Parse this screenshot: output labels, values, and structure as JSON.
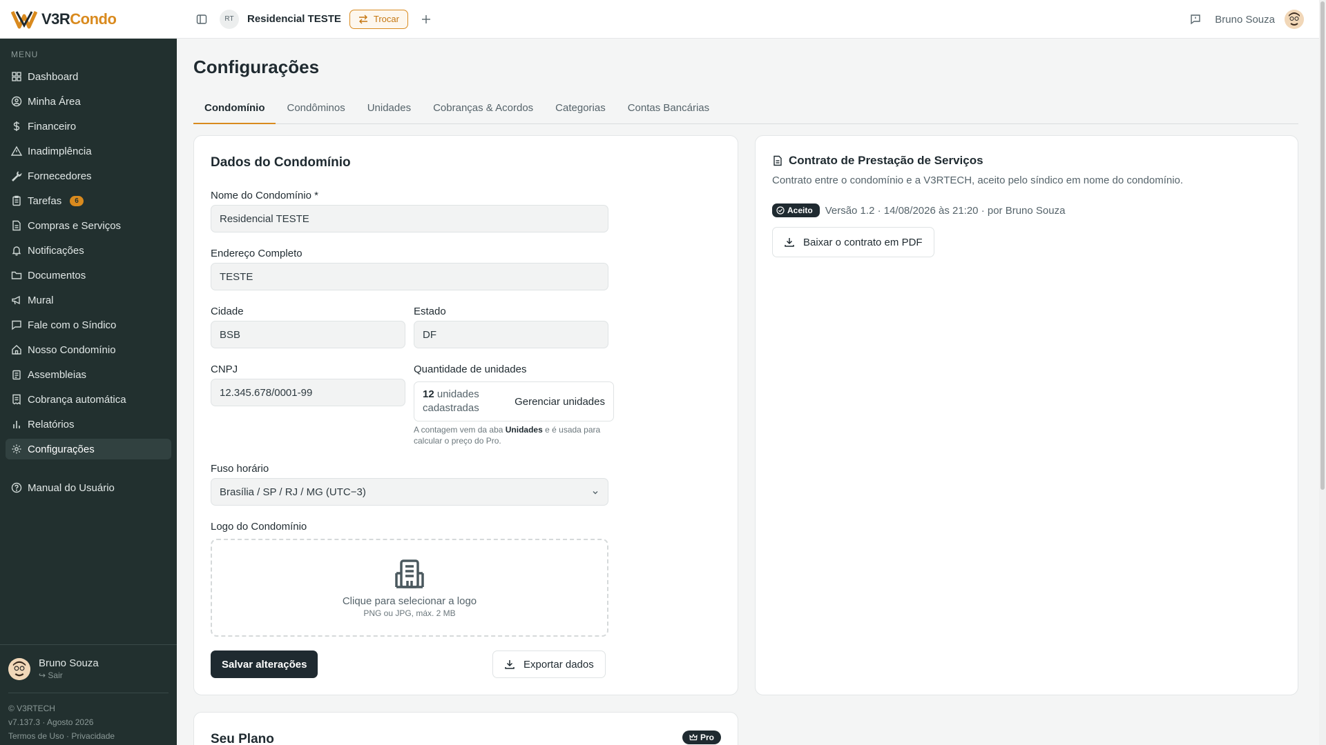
{
  "brand": {
    "logo_prefix": "V3R",
    "logo_suffix": "Condo"
  },
  "header": {
    "condo_initials": "RT",
    "condo_name": "Residencial TESTE",
    "switch_label": "Trocar",
    "user_name": "Bruno Souza"
  },
  "sidebar": {
    "menu_label": "MENU",
    "items": [
      {
        "label": "Dashboard",
        "icon": "grid-icon"
      },
      {
        "label": "Minha Área",
        "icon": "user-circle-icon"
      },
      {
        "label": "Financeiro",
        "icon": "dollar-icon"
      },
      {
        "label": "Inadimplência",
        "icon": "warning-icon"
      },
      {
        "label": "Fornecedores",
        "icon": "wrench-icon"
      },
      {
        "label": "Tarefas",
        "icon": "clipboard-icon",
        "badge": "6"
      },
      {
        "label": "Compras e Serviços",
        "icon": "document-icon"
      },
      {
        "label": "Notificações",
        "icon": "bell-icon"
      },
      {
        "label": "Documentos",
        "icon": "folder-icon"
      },
      {
        "label": "Mural",
        "icon": "megaphone-icon"
      },
      {
        "label": "Fale com o Síndico",
        "icon": "message-icon"
      },
      {
        "label": "Nosso Condomínio",
        "icon": "home-icon"
      },
      {
        "label": "Assembleias",
        "icon": "clipboard-list-icon"
      },
      {
        "label": "Cobrança automática",
        "icon": "receipt-icon"
      },
      {
        "label": "Relatórios",
        "icon": "bar-chart-icon"
      },
      {
        "label": "Configurações",
        "icon": "gear-icon"
      }
    ],
    "manual_label": "Manual do Usuário",
    "user_name": "Bruno Souza",
    "logout_label": "Sair",
    "copyright": "© V3RTECH",
    "version": "v7.137.3 · Agosto 2026",
    "terms_label": "Termos de Uso",
    "privacy_label": "Privacidade"
  },
  "page": {
    "title": "Configurações",
    "tabs": [
      "Condomínio",
      "Condôminos",
      "Unidades",
      "Cobranças & Acordos",
      "Categorias",
      "Contas Bancárias"
    ]
  },
  "form": {
    "title": "Dados do Condomínio",
    "name_label": "Nome do Condomínio *",
    "name_value": "Residencial TESTE",
    "address_label": "Endereço Completo",
    "address_value": "TESTE",
    "city_label": "Cidade",
    "city_value": "BSB",
    "state_label": "Estado",
    "state_value": "DF",
    "cnpj_label": "CNPJ",
    "cnpj_value": "12.345.678/0001-99",
    "units_label": "Quantidade de unidades",
    "units_count": "12",
    "units_suffix": "unidades cadastradas",
    "units_manage": "Gerenciar unidades",
    "units_hint_pre": "A contagem vem da aba",
    "units_hint_tab": "Unidades",
    "units_hint_post": "e é usada para calcular o preço do Pro.",
    "timezone_label": "Fuso horário",
    "timezone_value": "Brasília / SP / RJ / MG (UTC−3)",
    "logo_label": "Logo do Condomínio",
    "logo_cta": "Clique para selecionar a logo",
    "logo_hint": "PNG ou JPG, máx. 2 MB",
    "save_label": "Salvar alterações",
    "export_label": "Exportar dados"
  },
  "contract": {
    "title": "Contrato de Prestação de Serviços",
    "description": "Contrato entre o condomínio e a V3RTECH, aceito pelo síndico em nome do condomínio.",
    "status": "Aceito",
    "status_detail": "Versão 1.2 · 14/08/2026 às 21:20 · por Bruno Souza",
    "download_label": "Baixar o contrato em PDF"
  },
  "plan": {
    "title": "Seu Plano",
    "badge": "Pro"
  },
  "colors": {
    "accent": "#d98a1e",
    "sidebar": "#22302f",
    "dark": "#1f2a30"
  }
}
